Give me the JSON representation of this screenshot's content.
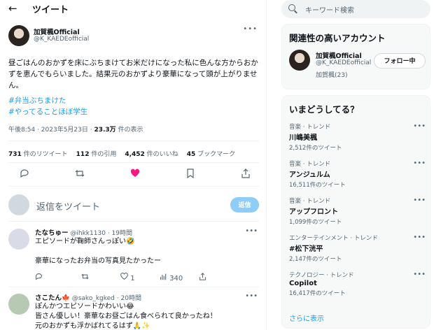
{
  "header": {
    "back_icon": "arrow-left-icon",
    "title": "ツイート"
  },
  "tweet": {
    "author_name": "加賀楓Official",
    "author_handle": "@K_KAEDEofficial",
    "text": "昼ごはんのおかずを床にぶちまけてお米だけになった私に色んな方からおかずを恵んでもらいました。結果元のおかずより豪華になって頭が上がりません。",
    "hashtags": [
      "#弁当ぶちまけた",
      "#やってることほぼ学生"
    ],
    "time": "午後8:54 · 2023年5月23日 · ",
    "views_count": "23.3万",
    "views_label": " 件の表示",
    "stats": {
      "retweets_count": "731",
      "retweets_label": " 件のリツイート",
      "quotes_count": "112",
      "quotes_label": " 件の引用",
      "likes_count": "4,452",
      "likes_label": " 件のいいね",
      "bookmarks_count": "45",
      "bookmarks_label": " ブックマーク"
    },
    "actions": [
      "reply-icon",
      "retweet-icon",
      "like-icon",
      "bookmark-icon",
      "share-icon"
    ]
  },
  "reply_box": {
    "placeholder": "返信をツイート",
    "button_label": "返信"
  },
  "replies": [
    {
      "name": "たなちゅー",
      "handle": "@ihkk1130",
      "time": "· 19時間",
      "lines": [
        "エピソードが鞠師さんっぽい🤣",
        "",
        "豪華になったお弁当の写真見たかったー"
      ],
      "counts": {
        "reply": "",
        "retweet": "",
        "like": "1",
        "views": "340"
      }
    },
    {
      "name": "さこたん🍁",
      "handle": "@sako_kgked",
      "time": "· 20時間",
      "lines": [
        "ぽんかつエピソードかわいい😂",
        "皆さん優しい！豪華なお昼ごはん食べられて良かったね！",
        "元のおかずも浮かばれてるはず🙏✨"
      ]
    }
  ],
  "sidebar": {
    "search_placeholder": "キーワード検索",
    "recommend": {
      "title": "関連性の高いアカウント",
      "name": "加賀楓Official",
      "handle": "@K_KAEDEofficial",
      "sub": "加賀楓(23)",
      "button": "フォロー中"
    },
    "trends": {
      "title": "いまどうしてる？",
      "items": [
        {
          "category": "音楽 · トレンド",
          "name": "川嶋美楓",
          "count": "2,512件のツイート"
        },
        {
          "category": "音楽 · トレンド",
          "name": "アンジュルム",
          "count": "16,511件のツイート"
        },
        {
          "category": "音楽 · トレンド",
          "name": "アップフロント",
          "count": "1,099件のツイート"
        },
        {
          "category": "エンターテインメント · トレンド",
          "name": "#松下洸平",
          "count": "2,147件のツイート"
        },
        {
          "category": "テクノロジー · トレンド",
          "name": "Copilot",
          "count": "16,417件のツイート"
        }
      ],
      "show_more": "さらに表示"
    }
  },
  "colors": {
    "accent": "#1d9bf0",
    "like": "#f91880",
    "muted": "#536471"
  }
}
